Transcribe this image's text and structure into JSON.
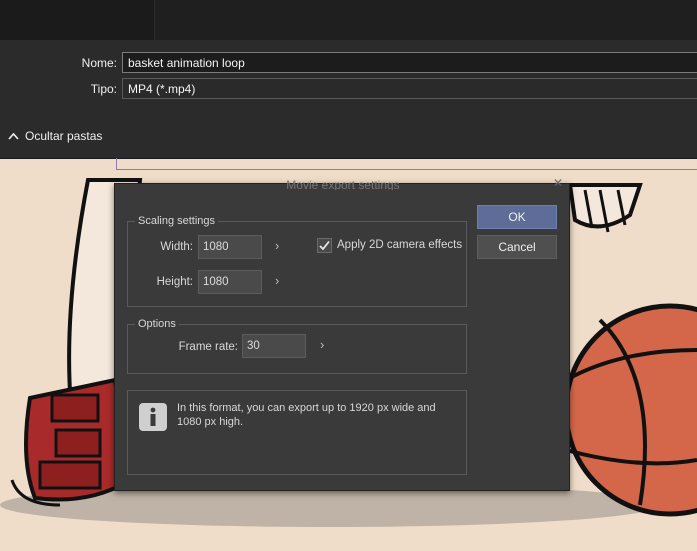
{
  "save_dialog": {
    "name_label": "Nome:",
    "name_value": "basket animation loop",
    "type_label": "Tipo:",
    "type_value": "MP4 (*.mp4)",
    "hide_folders_label": "Ocultar pastas"
  },
  "export_dialog": {
    "title": "Movie export settings",
    "close_glyph": "✕",
    "scaling": {
      "title": "Scaling settings",
      "width_label": "Width:",
      "width_value": "1080",
      "height_label": "Height:",
      "height_value": "1080",
      "camera_label": "Apply 2D camera effects",
      "camera_checked": true
    },
    "options": {
      "title": "Options",
      "frame_rate_label": "Frame rate:",
      "frame_rate_value": "30"
    },
    "info_text": "In this format, you can export up to 1920 px wide and 1080 px high.",
    "ok_label": "OK",
    "cancel_label": "Cancel",
    "arrow_glyph": "›"
  },
  "colors": {
    "canvas_bg": "#efdcc9",
    "dialog_bg": "#3a3a3a",
    "ok_button": "#5d6d98",
    "ball": "#d4674a",
    "shoe": "#a82a2a"
  }
}
